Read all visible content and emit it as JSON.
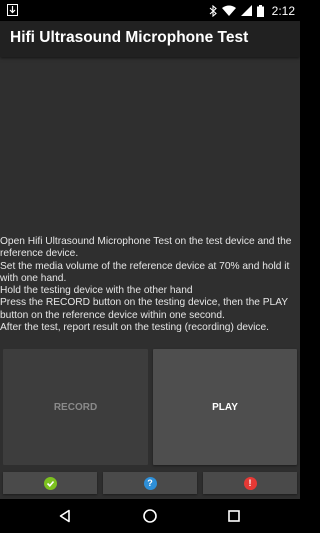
{
  "status_bar": {
    "time": "2:12",
    "left_icon": "download-notification-icon",
    "icons": [
      "bluetooth-icon",
      "wifi-icon",
      "cell-signal-icon",
      "battery-icon"
    ]
  },
  "app_bar": {
    "title": "Hifi Ultrasound Microphone Test",
    "background": "#212121"
  },
  "instructions": {
    "text": "Open Hifi Ultrasound Microphone Test on the test device and the reference device.\n Set the media volume of the reference device at 70% and hold it with one hand.\n Hold the testing device with the other hand\n Press the RECORD button on the testing device, then the PLAY button on the reference device within one second.\n After the test, report result on the testing (recording) device."
  },
  "buttons": {
    "record_label": "RECORD",
    "play_label": "PLAY"
  },
  "result_buttons": {
    "pass_icon": "check-icon",
    "pass_color": "#7cc11f",
    "info_icon": "question-icon",
    "info_color": "#2e8fd8",
    "fail_icon": "exclamation-icon",
    "fail_color": "#e53935"
  },
  "nav_bar": {
    "icons": [
      "back-icon",
      "home-icon",
      "recents-icon"
    ]
  }
}
